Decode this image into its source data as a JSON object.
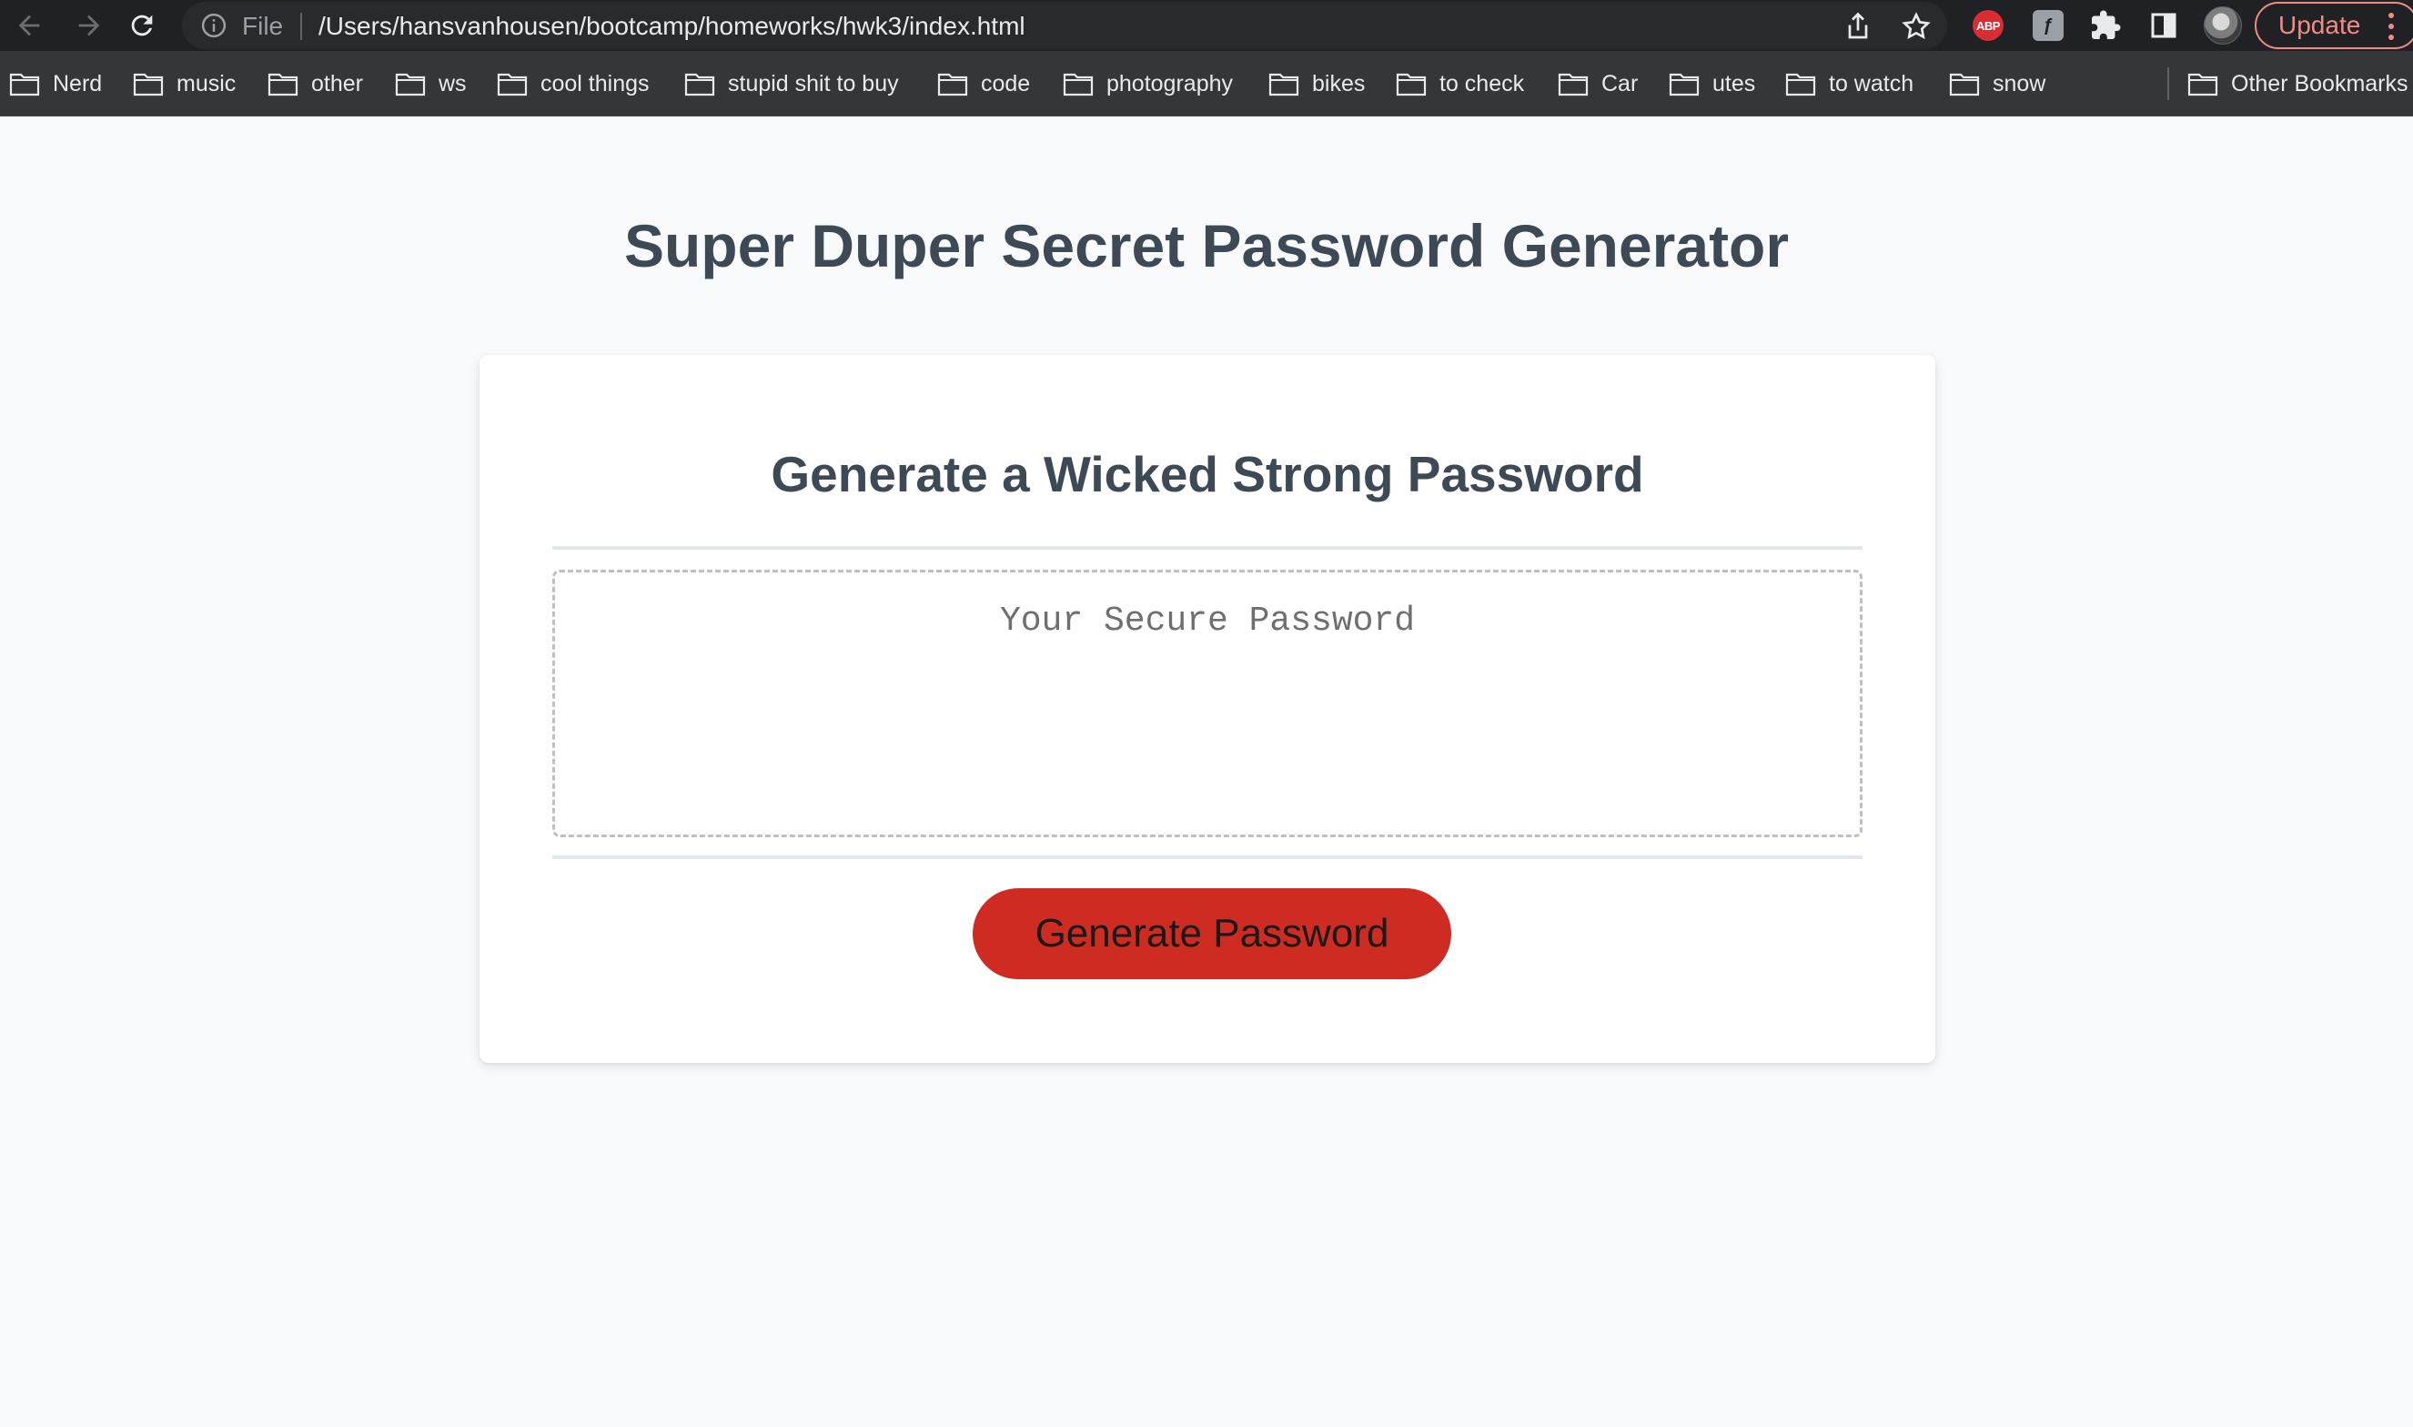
{
  "browser": {
    "omnibox": {
      "scheme_label": "File",
      "url": "/Users/hansvanhousen/bootcamp/homeworks/hwk3/index.html"
    },
    "extensions": {
      "abp_label": "ABP",
      "grey_ext_label": "ƒ"
    },
    "update_label": "Update",
    "bookmarks": [
      "Nerd",
      "music",
      "other",
      "ws",
      "cool things",
      "stupid shit to buy",
      "code",
      "photography",
      "bikes",
      "to check",
      "Car",
      "utes",
      "to watch",
      "snow"
    ],
    "other_bookmarks_label": "Other Bookmarks",
    "icons": [
      "back-icon",
      "forward-icon",
      "reload-icon",
      "info-icon",
      "share-icon",
      "star-icon",
      "puzzle-icon",
      "side-panel-icon",
      "kebab-menu-icon",
      "folder-icon"
    ]
  },
  "page": {
    "title": "Super Duper Secret Password Generator",
    "card_title": "Generate a Wicked Strong Password",
    "password_placeholder": "Your Secure Password",
    "password_value": "",
    "generate_button_label": "Generate Password"
  },
  "colors": {
    "chrome_dark": "#202124",
    "bookmark_bar": "#35363a",
    "page_background": "#f9fafb",
    "heading_text": "#3d4a55",
    "button_red": "#ce2b22",
    "update_accent": "#f28b82"
  }
}
